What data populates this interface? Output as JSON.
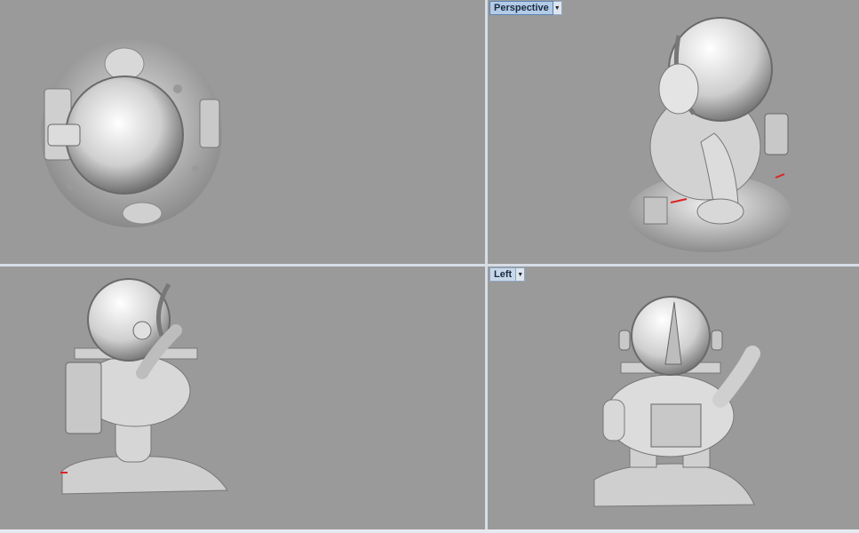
{
  "viewports": {
    "top": {
      "label": ""
    },
    "perspective": {
      "label": "Perspective",
      "dropdown_icon": "chevron-down-icon"
    },
    "front": {
      "label": ""
    },
    "left": {
      "label": "Left",
      "dropdown_icon": "chevron-down-icon"
    }
  },
  "colors": {
    "viewport_background": "#9a9a9a",
    "viewport_border": "#d7dde6",
    "model_shade": "#e6e6e6",
    "active_tab": "#b3cbe6"
  }
}
